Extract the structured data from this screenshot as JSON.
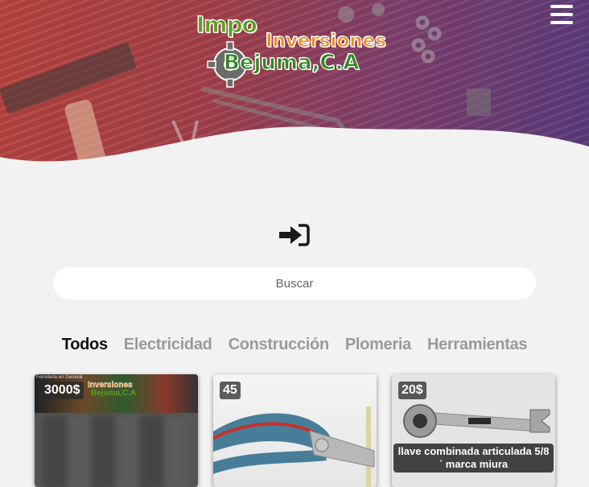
{
  "header": {
    "logo": {
      "line1": "Impo",
      "line2": "Inversiones",
      "line3": "Bejuma,C.A"
    }
  },
  "search": {
    "placeholder": "Buscar"
  },
  "filters": [
    {
      "label": "Todos",
      "active": true
    },
    {
      "label": "Electricidad",
      "active": false
    },
    {
      "label": "Construcción",
      "active": false
    },
    {
      "label": "Plomeria",
      "active": false
    },
    {
      "label": "Herramientas",
      "active": false
    }
  ],
  "products": [
    {
      "price": "3000$",
      "caption": "",
      "banner_line1": "Inversiones",
      "banner_line2": "Bejuma,C.A",
      "banner_small": "Ferreteria en General"
    },
    {
      "price": "45",
      "caption": ""
    },
    {
      "price": "20$",
      "caption": "llave combinada articulada 5/8´ marca miura"
    }
  ],
  "colors": {
    "accent_green": "#5e9f1f",
    "accent_orange": "#f08a1d",
    "hero_start": "#b8443d",
    "hero_end": "#5a3b7c"
  }
}
